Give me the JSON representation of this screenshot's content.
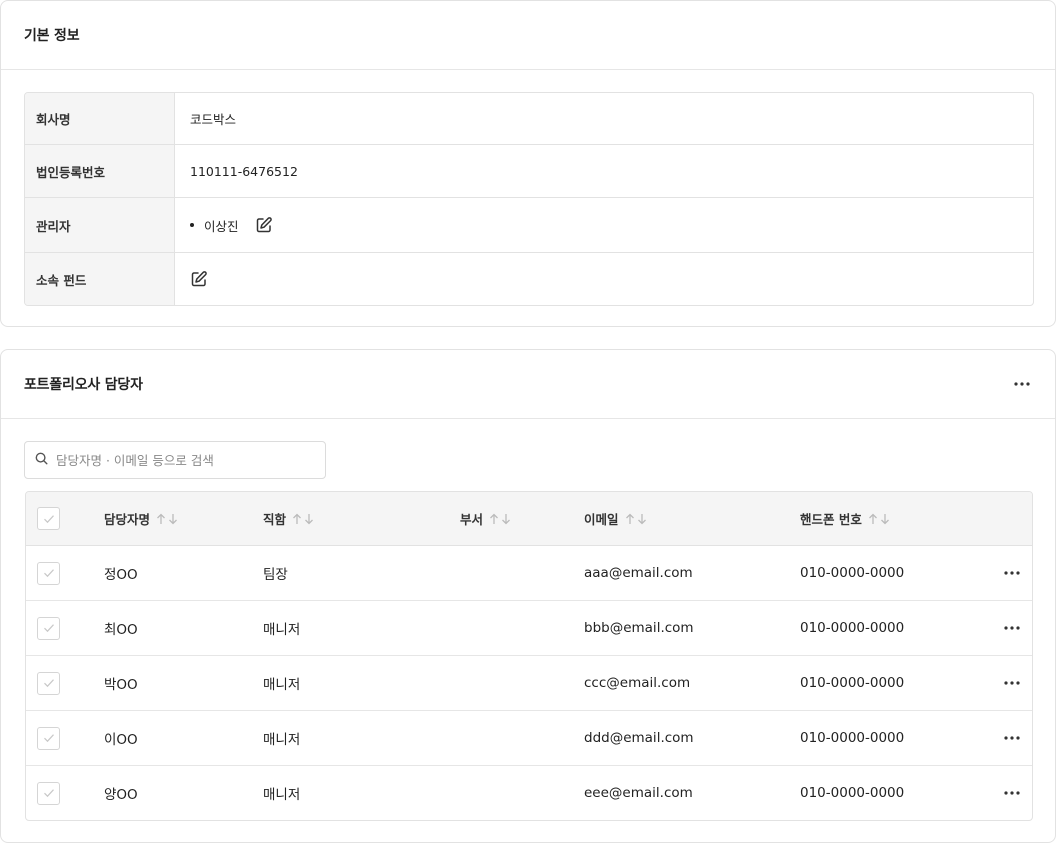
{
  "basic_info": {
    "title": "기본 정보",
    "rows": [
      {
        "label": "회사명",
        "value": "코드박스"
      },
      {
        "label": "법인등록번호",
        "value": "110111-6476512"
      },
      {
        "label": "관리자",
        "value": "이상진"
      },
      {
        "label": "소속 펀드",
        "value": ""
      }
    ]
  },
  "contacts": {
    "title": "포트폴리오사 담당자",
    "search_placeholder": "담당자명 · 이메일 등으로 검색",
    "columns": {
      "name": "담당자명",
      "title": "직함",
      "dept": "부서",
      "email": "이메일",
      "phone": "핸드폰 번호"
    },
    "rows": [
      {
        "name": "정OO",
        "title": "팀장",
        "dept": "",
        "email": "aaa@email.com",
        "phone": "010-0000-0000"
      },
      {
        "name": "최OO",
        "title": "매니저",
        "dept": "",
        "email": "bbb@email.com",
        "phone": "010-0000-0000"
      },
      {
        "name": "박OO",
        "title": "매니저",
        "dept": "",
        "email": "ccc@email.com",
        "phone": "010-0000-0000"
      },
      {
        "name": "이OO",
        "title": "매니저",
        "dept": "",
        "email": "ddd@email.com",
        "phone": "010-0000-0000"
      },
      {
        "name": "양OO",
        "title": "매니저",
        "dept": "",
        "email": "eee@email.com",
        "phone": "010-0000-0000"
      }
    ]
  },
  "icons": {
    "edit": "edit-icon",
    "more": "more-icon",
    "search": "search-icon",
    "check": "check-icon",
    "sort_up": "arrow-up-icon",
    "sort_down": "arrow-down-icon"
  }
}
